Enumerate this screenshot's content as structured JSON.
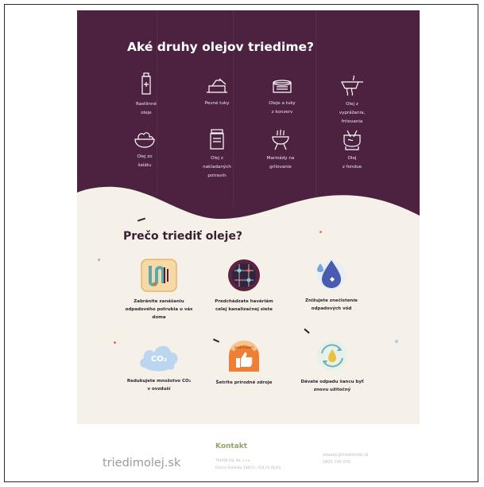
{
  "heading_oils": "Aké druhy olejov triedime?",
  "oil_types": [
    {
      "line1": "Rastlinné",
      "line2": "oleje",
      "line3": "",
      "icon": "bottle-icon"
    },
    {
      "line1": "Pevné tuky",
      "line2": "",
      "line3": "",
      "icon": "butter-icon"
    },
    {
      "line1": "Oleje a tuky",
      "line2": "z konzerv",
      "line3": "",
      "icon": "can-icon"
    },
    {
      "line1": "Olej z",
      "line2": "vyprážania,",
      "line3": "fritovania",
      "icon": "frying-pan-icon"
    },
    {
      "line1": "Olej zo",
      "line2": "šalátu",
      "line3": "",
      "icon": "salad-bowl-icon"
    },
    {
      "line1": "Olej z",
      "line2": "nakladaných",
      "line3": "potravín",
      "icon": "jar-icon"
    },
    {
      "line1": "Marinády na",
      "line2": "grilovanie",
      "line3": "",
      "icon": "grill-icon"
    },
    {
      "line1": "Olej",
      "line2": "z fondue",
      "line3": "",
      "icon": "fondue-pot-icon"
    }
  ],
  "heading_why": "Prečo triediť oleje?",
  "reasons": [
    {
      "line1": "Zabránite zanášaniu",
      "line2": "odpadového potrubia u vás",
      "line3": "doma",
      "icon": "clogged-pipe-icon"
    },
    {
      "line1": "Predchádzate haváriám",
      "line2": "celej kanalizačnej siete",
      "line3": "",
      "icon": "sewer-network-icon"
    },
    {
      "line1": "Znižujete znečistenie",
      "line2": "odpadových vôd",
      "line3": "",
      "icon": "water-drop-icon"
    },
    {
      "line1": "Redukujete množstvo CO₂",
      "line2": "v ovzduší",
      "line3": "",
      "icon": "co2-cloud-icon"
    },
    {
      "line1": "Šetríte prírodné zdroje",
      "line2": "",
      "line3": "",
      "icon": "thumbs-up-icon"
    },
    {
      "line1": "Dávate odpadu šancu byť",
      "line2": "znovu užitočný",
      "line3": "",
      "icon": "recycle-drop-icon"
    }
  ],
  "badge_texts": {
    "co2": "CO₂",
    "save_planet": "SAVE PLANET"
  },
  "footer": {
    "brand": "triedimolej.sk",
    "contact_heading": "Kontakt",
    "company": "TRAFIN OIL SK, s.r.o.",
    "address": "Dolina Šebešky 180/31, 014 01 Bytča",
    "email": "odpady@triedimolej.sk",
    "phone": "0800 700 070"
  },
  "colors": {
    "purple": "#4d2240",
    "cream": "#f5f1e9",
    "green": "#8fa36a",
    "orange": "#ee7f34"
  }
}
